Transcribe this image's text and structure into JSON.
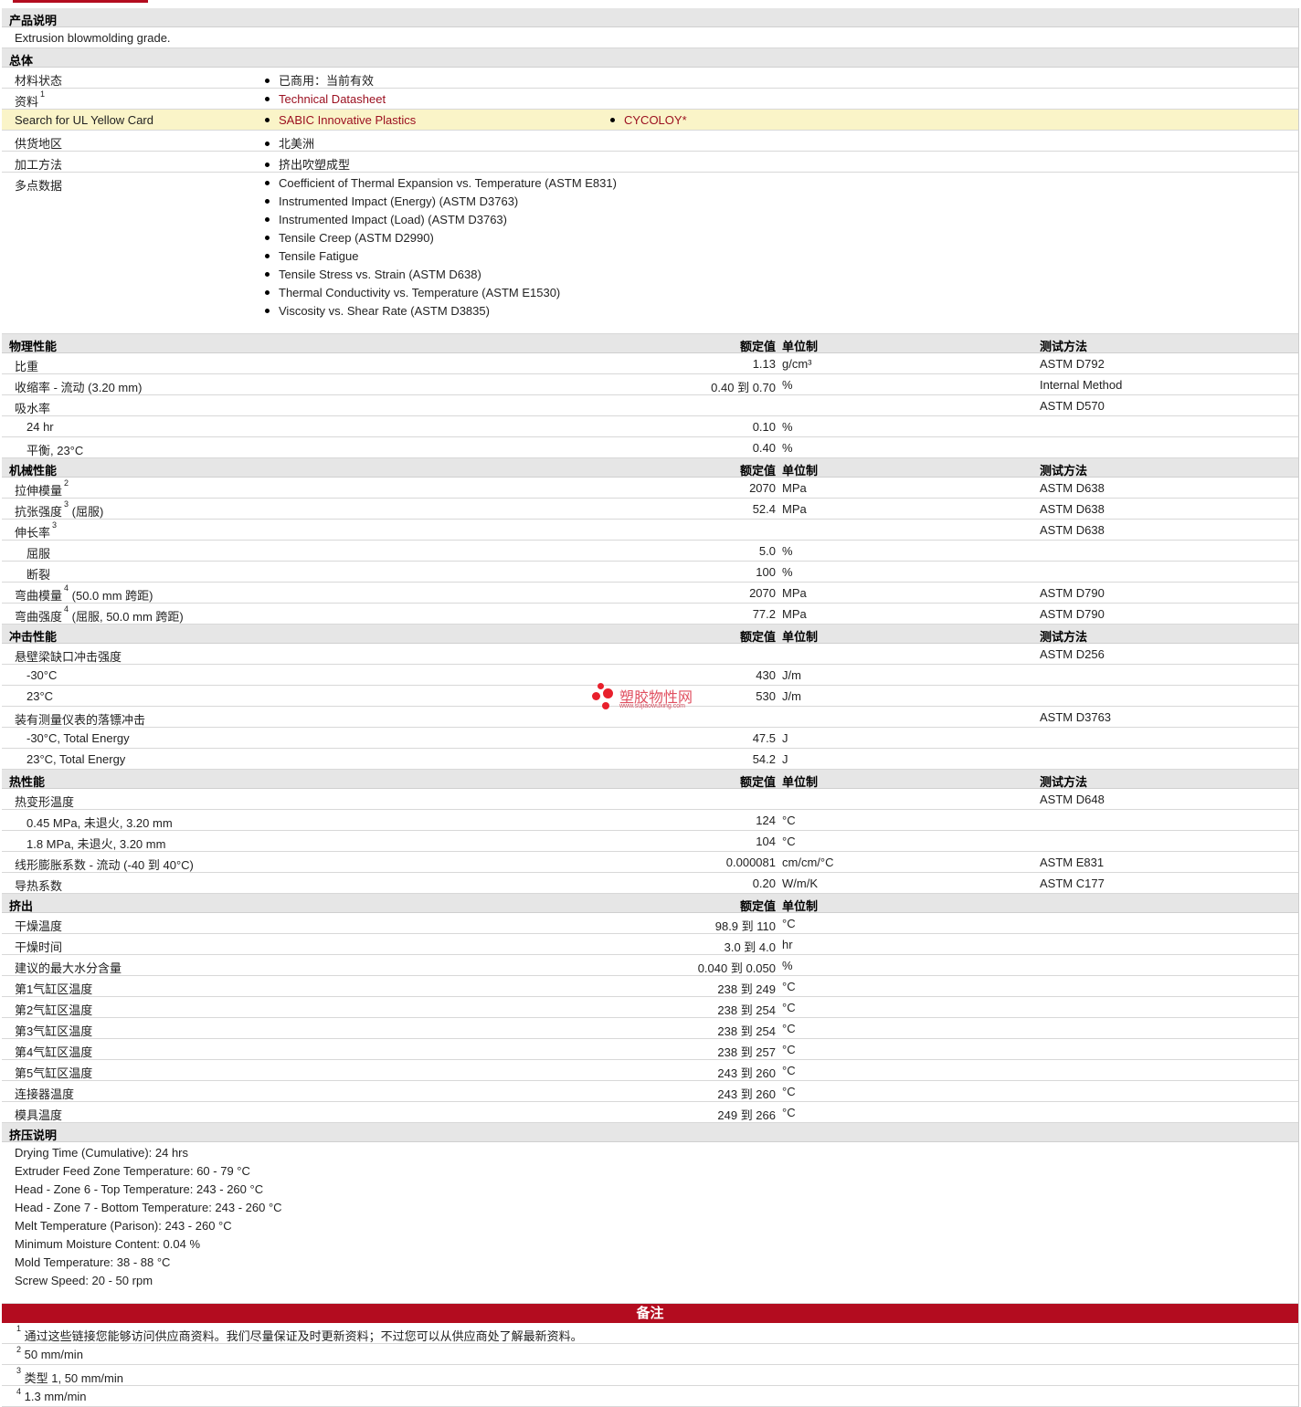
{
  "product_desc": {
    "title": "产品说明",
    "text": "Extrusion blowmolding grade."
  },
  "general": {
    "title": "总体",
    "status_label": "材料状态",
    "status_value": "已商用：当前有效",
    "info_label": "资料",
    "info_sup": "1",
    "info_value": "Technical Datasheet",
    "ul_label": "Search for UL Yellow Card",
    "ul_value1": "SABIC Innovative Plastics",
    "ul_value2": "CYCOLOY*",
    "region_label": "供货地区",
    "region_value": "北美洲",
    "process_label": "加工方法",
    "process_value": "挤出吹塑成型",
    "multi_label": "多点数据",
    "multi_items": [
      "Coefficient of Thermal Expansion vs. Temperature (ASTM E831)",
      "Instrumented Impact (Energy) (ASTM D3763)",
      "Instrumented Impact (Load) (ASTM D3763)",
      "Tensile Creep (ASTM D2990)",
      "Tensile Fatigue",
      "Tensile Stress vs. Strain (ASTM D638)",
      "Thermal Conductivity vs. Temperature (ASTM E1530)",
      "Viscosity vs. Shear Rate (ASTM D3835)"
    ]
  },
  "headers": {
    "value": "额定值",
    "unit": "单位制",
    "method": "测试方法"
  },
  "physical": {
    "title": "物理性能",
    "rows": [
      {
        "label": "比重",
        "value": "1.13",
        "unit": "g/cm³",
        "method": "ASTM D792"
      },
      {
        "label": "收缩率  - 流动  (3.20 mm)",
        "value": "0.40 到  0.70",
        "unit": "%",
        "method": "Internal Method"
      },
      {
        "label": "吸水率",
        "value": "",
        "unit": "",
        "method": "ASTM D570"
      },
      {
        "label": "24 hr",
        "value": "0.10",
        "unit": "%",
        "method": ""
      },
      {
        "label": "平衡, 23°C",
        "value": "0.40",
        "unit": "%",
        "method": ""
      }
    ]
  },
  "mechanical": {
    "title": "机械性能",
    "rows": [
      {
        "label": "拉伸模量",
        "sup": "2",
        "suffix": "",
        "value": "2070",
        "unit": "MPa",
        "method": "ASTM D638"
      },
      {
        "label": "抗张强度",
        "sup": "3",
        "suffix": " (屈服)",
        "value": "52.4",
        "unit": "MPa",
        "method": "ASTM D638"
      },
      {
        "label": "伸长率",
        "sup": "3",
        "suffix": "",
        "value": "",
        "unit": "",
        "method": "ASTM D638"
      },
      {
        "label": "屈服",
        "sup": "",
        "suffix": "",
        "value": "5.0",
        "unit": "%",
        "method": ""
      },
      {
        "label": "断裂",
        "sup": "",
        "suffix": "",
        "value": "100",
        "unit": "%",
        "method": ""
      },
      {
        "label": "弯曲模量",
        "sup": "4",
        "suffix": " (50.0 mm 跨距)",
        "value": "2070",
        "unit": "MPa",
        "method": "ASTM D790"
      },
      {
        "label": "弯曲强度",
        "sup": "4",
        "suffix": " (屈服, 50.0 mm 跨距)",
        "value": "77.2",
        "unit": "MPa",
        "method": "ASTM D790"
      }
    ]
  },
  "impact": {
    "title": "冲击性能",
    "rows": [
      {
        "label": "悬壁梁缺口冲击强度",
        "value": "",
        "unit": "",
        "method": "ASTM D256"
      },
      {
        "label": "-30°C",
        "value": "430",
        "unit": "J/m",
        "method": ""
      },
      {
        "label": "23°C",
        "value": "530",
        "unit": "J/m",
        "method": ""
      },
      {
        "label": "装有测量仪表的落镖冲击",
        "value": "",
        "unit": "",
        "method": "ASTM D3763"
      },
      {
        "label": "-30°C, Total Energy",
        "value": "47.5",
        "unit": "J",
        "method": ""
      },
      {
        "label": "23°C, Total Energy",
        "value": "54.2",
        "unit": "J",
        "method": ""
      }
    ]
  },
  "thermal": {
    "title": "热性能",
    "rows": [
      {
        "label": "热变形温度",
        "value": "",
        "unit": "",
        "method": "ASTM D648"
      },
      {
        "label": "0.45 MPa, 未退火, 3.20 mm",
        "value": "124",
        "unit": "°C",
        "method": ""
      },
      {
        "label": "1.8 MPa, 未退火, 3.20 mm",
        "value": "104",
        "unit": "°C",
        "method": ""
      },
      {
        "label": "线形膨胀系数  - 流动  (-40 到  40°C)",
        "value": "0.000081",
        "unit": "cm/cm/°C",
        "method": "ASTM E831"
      },
      {
        "label": "导热系数",
        "value": "0.20",
        "unit": "W/m/K",
        "method": "ASTM C177"
      }
    ]
  },
  "extrusion": {
    "title": "挤出",
    "rows": [
      {
        "label": "干燥温度",
        "value": "98.9 到  110",
        "unit": "°C"
      },
      {
        "label": "干燥时间",
        "value": "3.0 到  4.0",
        "unit": "hr"
      },
      {
        "label": "建议的最大水分含量",
        "value": "0.040 到  0.050",
        "unit": "%"
      },
      {
        "label": "第1气缸区温度",
        "value": "238 到  249",
        "unit": "°C"
      },
      {
        "label": "第2气缸区温度",
        "value": "238 到  254",
        "unit": "°C"
      },
      {
        "label": "第3气缸区温度",
        "value": "238 到  254",
        "unit": "°C"
      },
      {
        "label": "第4气缸区温度",
        "value": "238 到  257",
        "unit": "°C"
      },
      {
        "label": "第5气缸区温度",
        "value": "243 到  260",
        "unit": "°C"
      },
      {
        "label": "连接器温度",
        "value": "243 到  260",
        "unit": "°C"
      },
      {
        "label": "模具温度",
        "value": "249 到  266",
        "unit": "°C"
      }
    ]
  },
  "extrusion_notes": {
    "title": "挤压说明",
    "items": [
      "Drying Time (Cumulative): 24 hrs",
      "Extruder Feed Zone Temperature: 60 - 79 °C",
      "Head - Zone 6 - Top Temperature: 243 - 260 °C",
      "Head - Zone 7 - Bottom Temperature: 243 - 260 °C",
      "Melt Temperature (Parison): 243 - 260 °C",
      "Minimum Moisture Content: 0.04 %",
      "Mold Temperature: 38 - 88 °C",
      "Screw Speed: 20 - 50 rpm"
    ]
  },
  "notes": {
    "title": "备注",
    "items": [
      {
        "n": "1",
        "text": "通过这些链接您能够访问供应商资料。我们尽量保证及时更新资料；不过您可以从供应商处了解最新资料。"
      },
      {
        "n": "2",
        "text": "50 mm/min"
      },
      {
        "n": "3",
        "text": "类型  1, 50 mm/min"
      },
      {
        "n": "4",
        "text": "1.3 mm/min"
      }
    ]
  },
  "watermark": {
    "name": "塑胶物性网",
    "url": "www.sujiaowuxing.com"
  },
  "colors": {
    "accent": "#b30c1f",
    "link": "#9b1020",
    "highlight": "#faf4c8",
    "section_bg": "#e6e6e6"
  }
}
